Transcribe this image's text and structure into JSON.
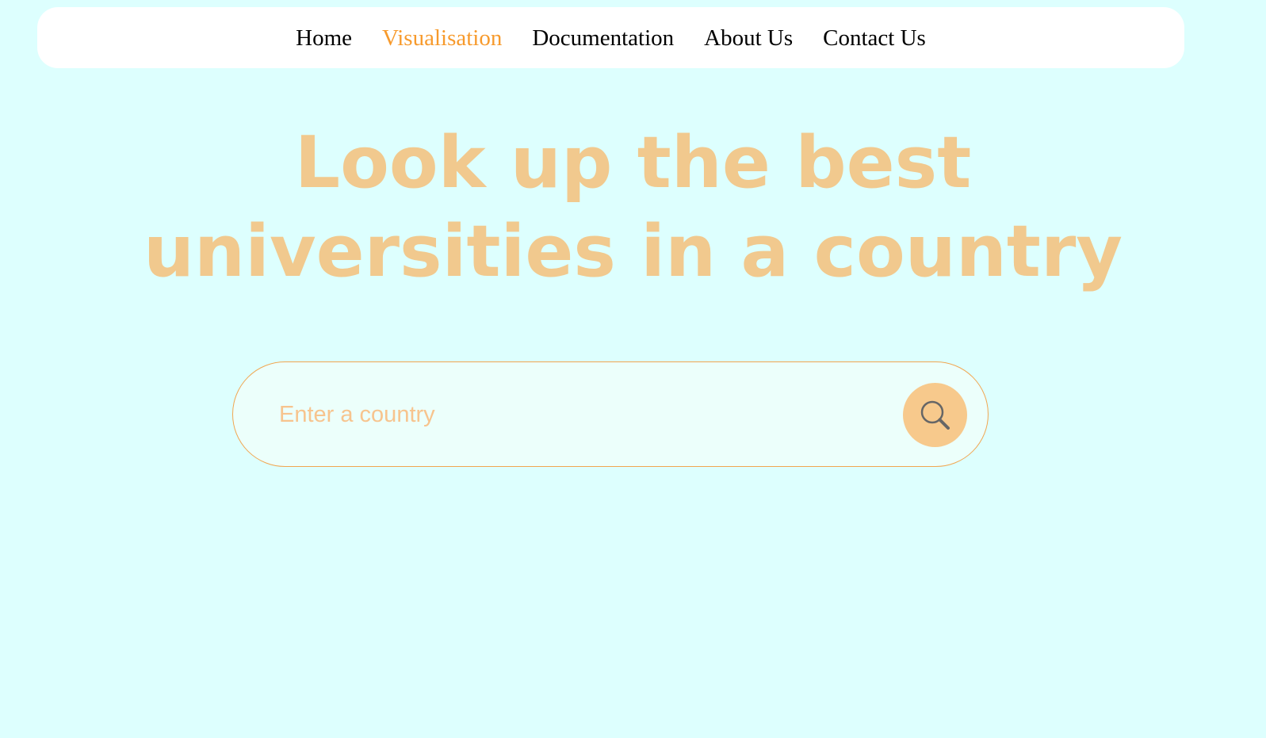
{
  "nav": {
    "items": [
      {
        "label": "Home",
        "active": false
      },
      {
        "label": "Visualisation",
        "active": true
      },
      {
        "label": "Documentation",
        "active": false
      },
      {
        "label": "About Us",
        "active": false
      },
      {
        "label": "Contact Us",
        "active": false
      }
    ]
  },
  "hero": {
    "title_line1": "Look up the best",
    "title_line2": "universities in a country"
  },
  "search": {
    "placeholder": "Enter a country",
    "value": "",
    "button_icon": "search-icon"
  },
  "colors": {
    "background": "#ddfffe",
    "nav_background": "#ffffff",
    "nav_active": "#f79a2c",
    "headline": "#f1c98e",
    "search_border": "#f1a651",
    "search_button": "#f7c98c"
  }
}
